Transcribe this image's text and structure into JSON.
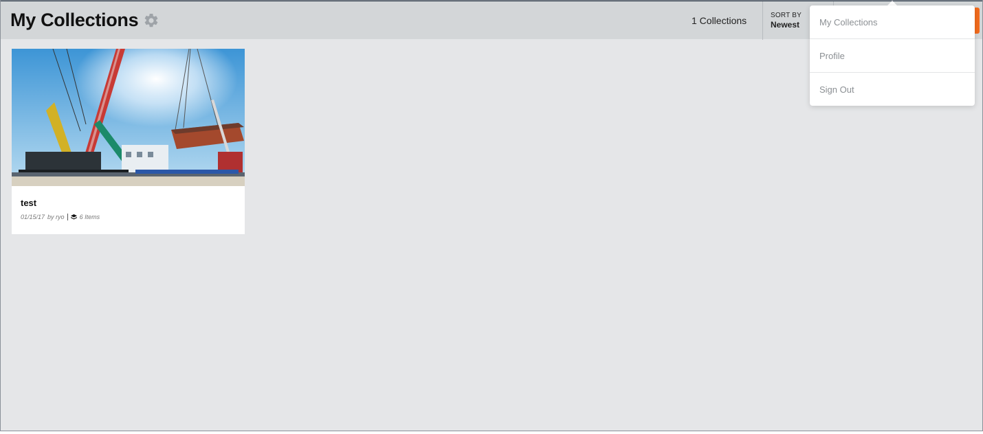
{
  "header": {
    "title": "My Collections",
    "collections_count": "1 Collections",
    "sort_label": "SORT BY",
    "sort_value": "Newest",
    "accent_color": "#f26b1d"
  },
  "collections": [
    {
      "title": "test",
      "date": "01/15/17",
      "author": "by ryo",
      "items": "6 Items",
      "image": "construction-crane-photo"
    }
  ],
  "user_menu": {
    "items": [
      {
        "label": "My Collections"
      },
      {
        "label": "Profile"
      },
      {
        "label": "Sign Out"
      }
    ]
  },
  "icons": {
    "settings": "gear-icon",
    "items": "layers-icon"
  }
}
